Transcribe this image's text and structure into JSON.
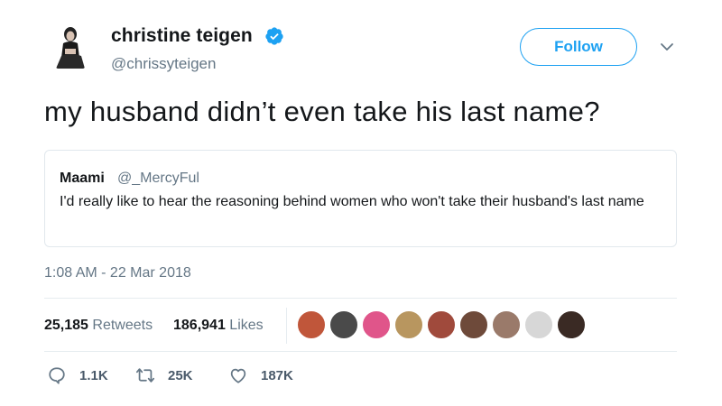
{
  "author": {
    "name": "christine teigen",
    "handle": "@chrissyteigen",
    "verified": true
  },
  "follow_button": {
    "label": "Follow"
  },
  "tweet": {
    "text": "my husband didn’t even take his last name?",
    "timestamp": "1:08 AM - 22 Mar 2018"
  },
  "quoted_tweet": {
    "name": "Maami",
    "handle": "@_MercyFul",
    "text": "I'd really like to hear the reasoning behind women who won't take their husband's last name"
  },
  "stats": {
    "retweets_count": "25,185",
    "retweets_label": "Retweets",
    "likes_count": "186,941",
    "likes_label": "Likes"
  },
  "actions": {
    "reply_count": "1.1K",
    "retweet_count": "25K",
    "like_count": "187K"
  },
  "colors": {
    "accent": "#1da1f2",
    "secondary_text": "#657786",
    "border": "#e1e8ed"
  }
}
